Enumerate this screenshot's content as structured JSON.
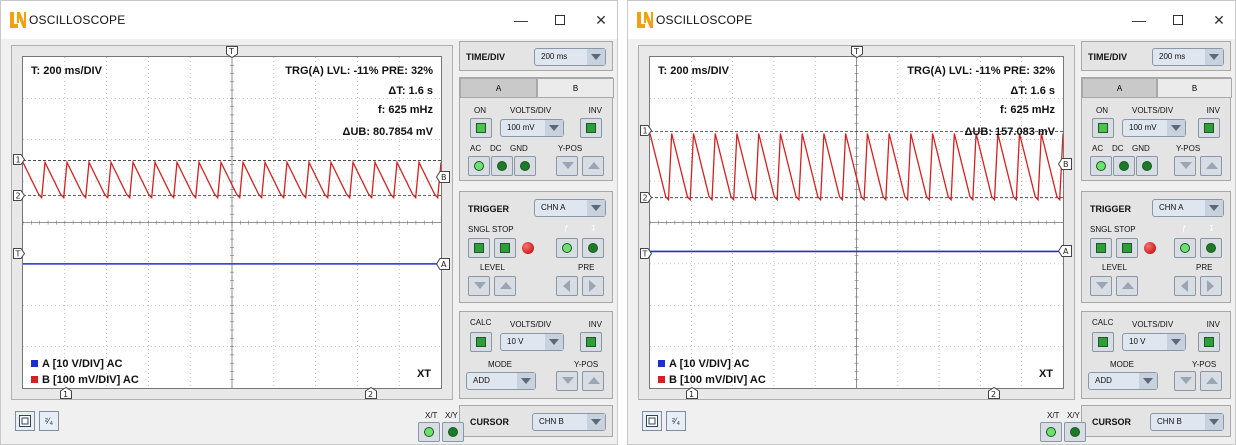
{
  "windows": [
    {
      "title": "OSCILLOSCOPE",
      "screen": {
        "timebase": "T: 200 ms/DIV",
        "trigger_info": "TRG(A) LVL: -11% PRE: 32%",
        "delta_t": "ΔT: 1.6 s",
        "frequency": "f: 625 mHz",
        "delta_ub": "ΔUB: 80.7854 mV",
        "legend_a": "A [10 V/DIV] AC",
        "legend_b": "B [100 mV/DIV] AC",
        "mode": "XT",
        "cursor_marker_1": "1",
        "cursor_marker_2": "2",
        "trigger_marker": "T",
        "channel_a_marker": "A",
        "channel_b_marker": "B"
      },
      "signal": {
        "channel_b_upper_cursor_div": 1.5,
        "channel_b_lower_cursor_div": 0.65,
        "cycles": 19,
        "channel_a_level_div": -1.0
      }
    },
    {
      "title": "OSCILLOSCOPE",
      "screen": {
        "timebase": "T: 200 ms/DIV",
        "trigger_info": "TRG(A) LVL: -11% PRE: 32%",
        "delta_t": "ΔT: 1.6 s",
        "frequency": "f: 625 mHz",
        "delta_ub": "ΔUB: 157.083 mV",
        "legend_a": "A [10 V/DIV] AC",
        "legend_b": "B [100 mV/DIV] AC",
        "mode": "XT",
        "cursor_marker_1": "1",
        "cursor_marker_2": "2",
        "trigger_marker": "T",
        "channel_a_marker": "A",
        "channel_b_marker": "B"
      },
      "signal": {
        "channel_b_upper_cursor_div": 2.2,
        "channel_b_lower_cursor_div": 0.6,
        "cycles": 19,
        "channel_a_level_div": -0.7
      }
    }
  ],
  "panel": {
    "time_div_label": "TIME/DIV",
    "time_div_value": "200 ms",
    "tab_a": "A",
    "tab_b": "B",
    "on_label": "ON",
    "volts_div_label": "VOLTS/DIV",
    "inv_label": "INV",
    "volts_div_value": "100 mV",
    "ac_label": "AC",
    "dc_label": "DC",
    "gnd_label": "GND",
    "ypos_label": "Y-POS",
    "trigger_label": "TRIGGER",
    "trigger_value": "CHN A",
    "sngl_label": "SNGL",
    "stop_label": "STOP",
    "level_label": "LEVEL",
    "pre_label": "PRE",
    "calc_label": "CALC",
    "calc_volts_div_value": "10 V",
    "mode_label": "MODE",
    "mode_value": "ADD",
    "cursor_label": "CURSOR",
    "cursor_value": "CHN B",
    "xt_label": "X/T",
    "xy_label": "X/Y",
    "bottom_btn_2": "²⁄₄"
  },
  "colors": {
    "trace_b": "#d42020",
    "trace_a": "#1c2fd0",
    "grid": "#9a9a9a",
    "led_green": "#2e9e3a",
    "led_red": "#c00000",
    "logo": "#f0a010"
  }
}
